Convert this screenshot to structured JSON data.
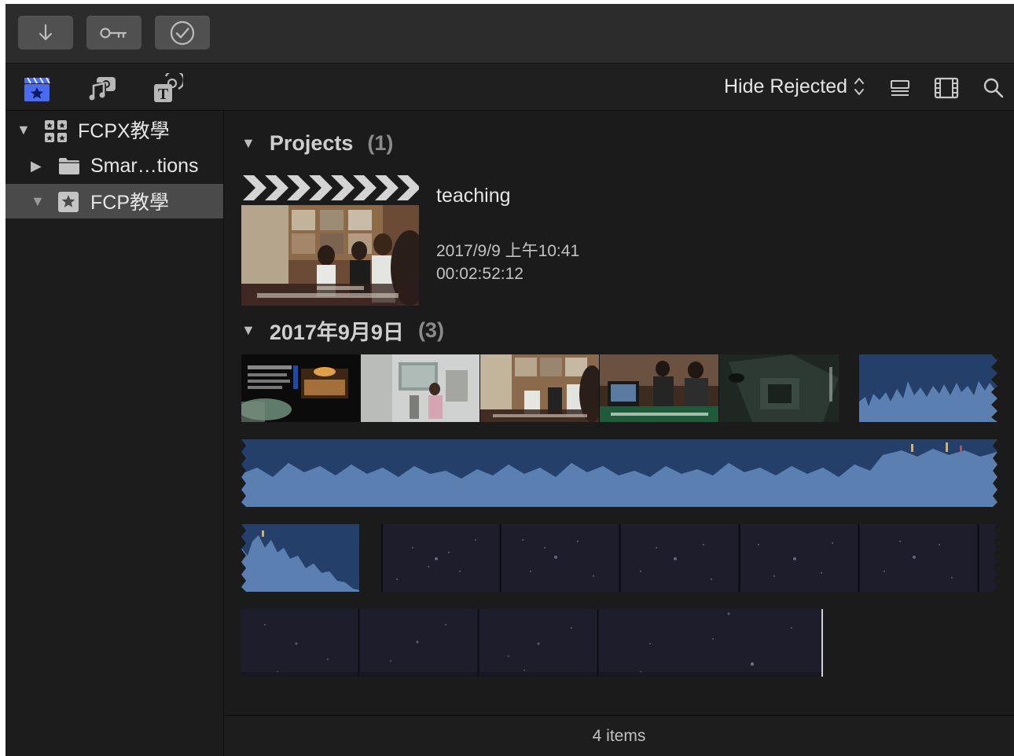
{
  "toolbar": {
    "buttons": [
      {
        "name": "import-button",
        "icon": "download-arrow-icon"
      },
      {
        "name": "keywords-button",
        "icon": "key-icon"
      },
      {
        "name": "background-tasks-button",
        "icon": "checkmark-circle-icon"
      }
    ]
  },
  "browser_header": {
    "tabs": [
      {
        "name": "libraries-tab",
        "icon": "clapper-star-icon",
        "active": true
      },
      {
        "name": "photos-audio-tab",
        "icon": "music-camera-icon",
        "active": false
      },
      {
        "name": "titles-generators-tab",
        "icon": "title-t-icon",
        "active": false
      }
    ],
    "filter_label": "Hide Rejected",
    "right_icons": [
      "list-view-icon",
      "filmstrip-view-icon",
      "search-icon"
    ]
  },
  "sidebar": {
    "items": [
      {
        "label": "FCPX教學",
        "icon": "library-grid-icon",
        "expanded": true,
        "selected": false
      },
      {
        "label": "Smar…tions",
        "icon": "folder-icon",
        "expanded": false,
        "selected": false
      },
      {
        "label": "FCP教學",
        "icon": "event-star-icon",
        "expanded": true,
        "selected": true
      }
    ]
  },
  "projects": {
    "heading": "Projects",
    "count": "(1)",
    "item": {
      "name": "teaching",
      "date": "2017/9/9 上午10:41",
      "duration": "00:02:52:12"
    }
  },
  "event_group": {
    "heading": "2017年9月9日",
    "count": "(3)"
  },
  "status": {
    "items_label": "4 items"
  },
  "colors": {
    "window_bg": "#1c1c1d",
    "audio_wave_dark": "#24406a",
    "audio_wave_light": "#5a7fb0",
    "selection": "#4a4a4b"
  }
}
